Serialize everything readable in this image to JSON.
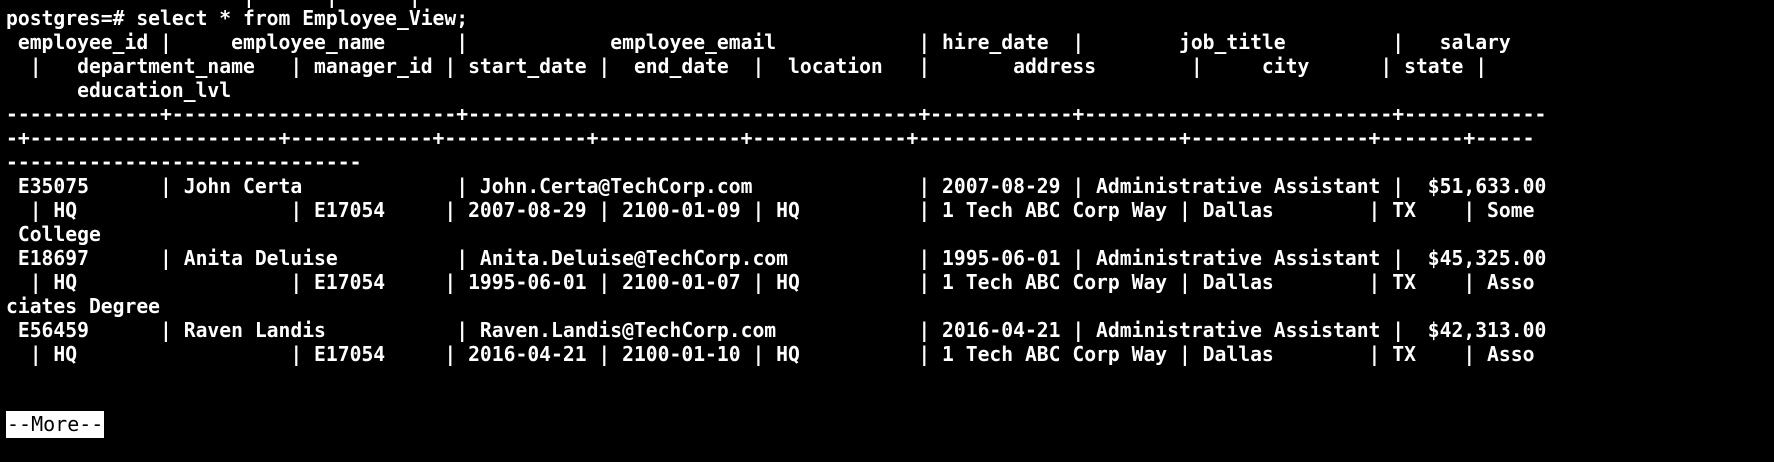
{
  "terminal": {
    "background": "#000000",
    "foreground": "#ffffff",
    "previous_line_partial": "                    |      |      |",
    "prompt": "postgres=# select * from Employee_View;",
    "output_lines": [
      " employee_id |     employee_name      |            employee_email            | hire_date  |        job_title         |   salary",
      "  |   department_name   | manager_id | start_date |  end_date  |  location   |       address        |     city      | state |",
      "      education_lvl",
      "-------------+------------------------+--------------------------------------+------------+--------------------------+------------",
      "-+---------------------+------------+------------+------------+-------------+----------------------+---------------+-------+-----",
      "------------------------------",
      " E35075      | John Certa             | John.Certa@TechCorp.com              | 2007-08-29 | Administrative Assistant |  $51,633.00",
      "  | HQ                  | E17054     | 2007-08-29 | 2100-01-09 | HQ          | 1 Tech ABC Corp Way | Dallas        | TX    | Some",
      " College",
      " E18697      | Anita Deluise          | Anita.Deluise@TechCorp.com           | 1995-06-01 | Administrative Assistant |  $45,325.00",
      "  | HQ                  | E17054     | 1995-06-01 | 2100-01-07 | HQ          | 1 Tech ABC Corp Way | Dallas        | TX    | Asso",
      "ciates Degree",
      " E56459      | Raven Landis           | Raven.Landis@TechCorp.com            | 2016-04-21 | Administrative Assistant |  $42,313.00",
      "  | HQ                  | E17054     | 2016-04-21 | 2100-01-10 | HQ          | 1 Tech ABC Corp Way | Dallas        | TX    | Asso"
    ],
    "pager_prompt": "--More--"
  }
}
